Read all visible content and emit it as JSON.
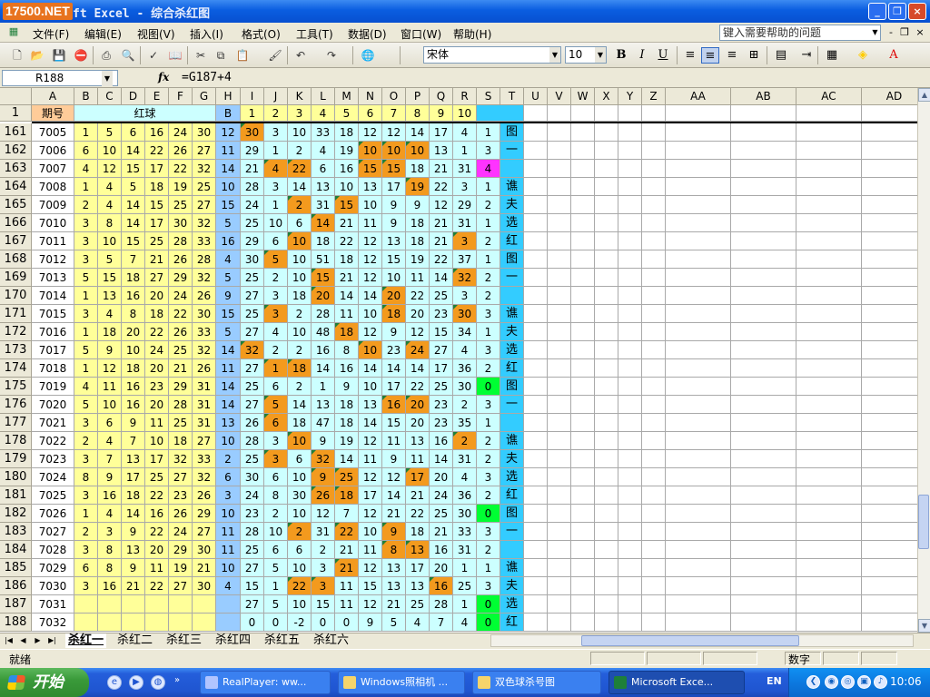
{
  "window": {
    "logo": "17500.NET",
    "title": "ft Excel - 综合杀红图",
    "min": "_",
    "restore": "❐",
    "close": "×"
  },
  "menu": [
    "文件(F)",
    "编辑(E)",
    "视图(V)",
    "插入(I)",
    "格式(O)",
    "工具(T)",
    "数据(D)",
    "窗口(W)",
    "帮助(H)"
  ],
  "help_placeholder": "键入需要帮助的问题",
  "toolbar": {
    "font": "宋体",
    "size": "10",
    "bold": "B",
    "italic": "I",
    "underline": "U"
  },
  "formula": {
    "namebox": "R188",
    "fx": "fx",
    "content": "=G187+4"
  },
  "columns": [
    "A",
    "B",
    "C",
    "D",
    "E",
    "F",
    "G",
    "H",
    "I",
    "J",
    "K",
    "L",
    "M",
    "N",
    "O",
    "P",
    "Q",
    "R",
    "S",
    "T",
    "U",
    "V",
    "W",
    "X",
    "Y",
    "Z",
    "AA",
    "AB",
    "AC",
    "AD"
  ],
  "header_row": {
    "row": "1",
    "period": "期号",
    "red": "红球",
    "blue": "B",
    "nums": [
      "1",
      "2",
      "3",
      "4",
      "5",
      "6",
      "7",
      "8",
      "9",
      "10"
    ]
  },
  "rows": [
    {
      "r": "161",
      "p": "7005",
      "red": [
        "1",
        "5",
        "6",
        "16",
        "24",
        "30"
      ],
      "b": "12",
      "kill": [
        "30",
        "3",
        "10",
        "33",
        "18",
        "12",
        "12",
        "14",
        "17",
        "4"
      ],
      "s": "1",
      "t": "图"
    },
    {
      "r": "162",
      "p": "7006",
      "red": [
        "6",
        "10",
        "14",
        "22",
        "26",
        "27"
      ],
      "b": "11",
      "kill": [
        "29",
        "1",
        "2",
        "4",
        "19",
        "10",
        "10",
        "10",
        "13",
        "1"
      ],
      "s": "3",
      "t": "一"
    },
    {
      "r": "163",
      "p": "7007",
      "red": [
        "4",
        "12",
        "15",
        "17",
        "22",
        "32"
      ],
      "b": "14",
      "kill": [
        "21",
        "4",
        "22",
        "6",
        "16",
        "15",
        "15",
        "18",
        "21",
        "31"
      ],
      "s": "4",
      "t": ""
    },
    {
      "r": "164",
      "p": "7008",
      "red": [
        "1",
        "4",
        "5",
        "18",
        "19",
        "25"
      ],
      "b": "10",
      "kill": [
        "28",
        "3",
        "14",
        "13",
        "10",
        "13",
        "17",
        "19",
        "22",
        "3"
      ],
      "s": "1",
      "t": "谯"
    },
    {
      "r": "165",
      "p": "7009",
      "red": [
        "2",
        "4",
        "14",
        "15",
        "25",
        "27"
      ],
      "b": "15",
      "kill": [
        "24",
        "1",
        "2",
        "31",
        "15",
        "10",
        "9",
        "9",
        "12",
        "29"
      ],
      "s": "2",
      "t": "夫"
    },
    {
      "r": "166",
      "p": "7010",
      "red": [
        "3",
        "8",
        "14",
        "17",
        "30",
        "32"
      ],
      "b": "5",
      "kill": [
        "25",
        "10",
        "6",
        "14",
        "21",
        "11",
        "9",
        "18",
        "21",
        "31"
      ],
      "s": "1",
      "t": "选"
    },
    {
      "r": "167",
      "p": "7011",
      "red": [
        "3",
        "10",
        "15",
        "25",
        "28",
        "33"
      ],
      "b": "16",
      "kill": [
        "29",
        "6",
        "10",
        "18",
        "22",
        "12",
        "13",
        "18",
        "21",
        "3"
      ],
      "s": "2",
      "t": "红"
    },
    {
      "r": "168",
      "p": "7012",
      "red": [
        "3",
        "5",
        "7",
        "21",
        "26",
        "28"
      ],
      "b": "4",
      "kill": [
        "30",
        "5",
        "10",
        "51",
        "18",
        "12",
        "15",
        "19",
        "22",
        "37"
      ],
      "s": "1",
      "t": "图"
    },
    {
      "r": "169",
      "p": "7013",
      "red": [
        "5",
        "15",
        "18",
        "27",
        "29",
        "32"
      ],
      "b": "5",
      "kill": [
        "25",
        "2",
        "10",
        "15",
        "21",
        "12",
        "10",
        "11",
        "14",
        "32"
      ],
      "s": "2",
      "t": "一"
    },
    {
      "r": "170",
      "p": "7014",
      "red": [
        "1",
        "13",
        "16",
        "20",
        "24",
        "26"
      ],
      "b": "9",
      "kill": [
        "27",
        "3",
        "18",
        "20",
        "14",
        "14",
        "20",
        "22",
        "25",
        "3"
      ],
      "s": "2",
      "t": ""
    },
    {
      "r": "171",
      "p": "7015",
      "red": [
        "3",
        "4",
        "8",
        "18",
        "22",
        "30"
      ],
      "b": "15",
      "kill": [
        "25",
        "3",
        "2",
        "28",
        "11",
        "10",
        "18",
        "20",
        "23",
        "30"
      ],
      "s": "3",
      "t": "谯"
    },
    {
      "r": "172",
      "p": "7016",
      "red": [
        "1",
        "18",
        "20",
        "22",
        "26",
        "33"
      ],
      "b": "5",
      "kill": [
        "27",
        "4",
        "10",
        "48",
        "18",
        "12",
        "9",
        "12",
        "15",
        "34"
      ],
      "s": "1",
      "t": "夫"
    },
    {
      "r": "173",
      "p": "7017",
      "red": [
        "5",
        "9",
        "10",
        "24",
        "25",
        "32"
      ],
      "b": "14",
      "kill": [
        "32",
        "2",
        "2",
        "16",
        "8",
        "10",
        "23",
        "24",
        "27",
        "4"
      ],
      "s": "3",
      "t": "选"
    },
    {
      "r": "174",
      "p": "7018",
      "red": [
        "1",
        "12",
        "18",
        "20",
        "21",
        "26"
      ],
      "b": "11",
      "kill": [
        "27",
        "1",
        "18",
        "14",
        "16",
        "14",
        "14",
        "14",
        "17",
        "36"
      ],
      "s": "2",
      "t": "红"
    },
    {
      "r": "175",
      "p": "7019",
      "red": [
        "4",
        "11",
        "16",
        "23",
        "29",
        "31"
      ],
      "b": "14",
      "kill": [
        "25",
        "6",
        "2",
        "1",
        "9",
        "10",
        "17",
        "22",
        "25",
        "30"
      ],
      "s": "0",
      "t": "图"
    },
    {
      "r": "176",
      "p": "7020",
      "red": [
        "5",
        "10",
        "16",
        "20",
        "28",
        "31"
      ],
      "b": "14",
      "kill": [
        "27",
        "5",
        "14",
        "13",
        "18",
        "13",
        "16",
        "20",
        "23",
        "2"
      ],
      "s": "3",
      "t": "一"
    },
    {
      "r": "177",
      "p": "7021",
      "red": [
        "3",
        "6",
        "9",
        "11",
        "25",
        "31"
      ],
      "b": "13",
      "kill": [
        "26",
        "6",
        "18",
        "47",
        "18",
        "14",
        "15",
        "20",
        "23",
        "35"
      ],
      "s": "1",
      "t": ""
    },
    {
      "r": "178",
      "p": "7022",
      "red": [
        "2",
        "4",
        "7",
        "10",
        "18",
        "27"
      ],
      "b": "10",
      "kill": [
        "28",
        "3",
        "10",
        "9",
        "19",
        "12",
        "11",
        "13",
        "16",
        "2"
      ],
      "s": "2",
      "t": "谯"
    },
    {
      "r": "179",
      "p": "7023",
      "red": [
        "3",
        "7",
        "13",
        "17",
        "32",
        "33"
      ],
      "b": "2",
      "kill": [
        "25",
        "3",
        "6",
        "32",
        "14",
        "11",
        "9",
        "11",
        "14",
        "31"
      ],
      "s": "2",
      "t": "夫"
    },
    {
      "r": "180",
      "p": "7024",
      "red": [
        "8",
        "9",
        "17",
        "25",
        "27",
        "32"
      ],
      "b": "6",
      "kill": [
        "30",
        "6",
        "10",
        "9",
        "25",
        "12",
        "12",
        "17",
        "20",
        "4"
      ],
      "s": "3",
      "t": "选"
    },
    {
      "r": "181",
      "p": "7025",
      "red": [
        "3",
        "16",
        "18",
        "22",
        "23",
        "26"
      ],
      "b": "3",
      "kill": [
        "24",
        "8",
        "30",
        "26",
        "18",
        "17",
        "14",
        "21",
        "24",
        "36"
      ],
      "s": "2",
      "t": "红"
    },
    {
      "r": "182",
      "p": "7026",
      "red": [
        "1",
        "4",
        "14",
        "16",
        "26",
        "29"
      ],
      "b": "10",
      "kill": [
        "23",
        "2",
        "10",
        "12",
        "7",
        "12",
        "21",
        "22",
        "25",
        "30"
      ],
      "s": "0",
      "t": "图"
    },
    {
      "r": "183",
      "p": "7027",
      "red": [
        "2",
        "3",
        "9",
        "22",
        "24",
        "27"
      ],
      "b": "11",
      "kill": [
        "28",
        "10",
        "2",
        "31",
        "22",
        "10",
        "9",
        "18",
        "21",
        "33"
      ],
      "s": "3",
      "t": "一"
    },
    {
      "r": "184",
      "p": "7028",
      "red": [
        "3",
        "8",
        "13",
        "20",
        "29",
        "30"
      ],
      "b": "11",
      "kill": [
        "25",
        "6",
        "6",
        "2",
        "21",
        "11",
        "8",
        "13",
        "16",
        "31"
      ],
      "s": "2",
      "t": ""
    },
    {
      "r": "185",
      "p": "7029",
      "red": [
        "6",
        "8",
        "9",
        "11",
        "19",
        "21"
      ],
      "b": "10",
      "kill": [
        "27",
        "5",
        "10",
        "3",
        "21",
        "12",
        "13",
        "17",
        "20",
        "1"
      ],
      "s": "1",
      "t": "谯"
    },
    {
      "r": "186",
      "p": "7030",
      "red": [
        "3",
        "16",
        "21",
        "22",
        "27",
        "30"
      ],
      "b": "4",
      "kill": [
        "15",
        "1",
        "22",
        "3",
        "11",
        "15",
        "13",
        "13",
        "16",
        "25"
      ],
      "s": "3",
      "t": "夫"
    },
    {
      "r": "187",
      "p": "7031",
      "red": [
        "",
        "",
        "",
        "",
        "",
        ""
      ],
      "b": "",
      "kill": [
        "27",
        "5",
        "10",
        "15",
        "11",
        "12",
        "21",
        "25",
        "28",
        "1"
      ],
      "s": "0",
      "t": "选"
    },
    {
      "r": "188",
      "p": "7032",
      "red": [
        "",
        "",
        "",
        "",
        "",
        ""
      ],
      "b": "",
      "kill": [
        "0",
        "0",
        "-2",
        "0",
        "0",
        "9",
        "5",
        "4",
        "7",
        "4"
      ],
      "s": "0",
      "t": "红"
    }
  ],
  "sheets": [
    "杀红一",
    "杀红二",
    "杀红三",
    "杀红四",
    "杀红五",
    "杀红六"
  ],
  "status": {
    "left": "就绪",
    "mode": "数字"
  },
  "taskbar": {
    "start": "开始",
    "tasks": [
      "RealPlayer: ww...",
      "Windows照相机 ...",
      "双色球杀号图",
      "Microsoft Exce..."
    ],
    "lang": "EN",
    "clock": "10:06"
  },
  "colors": {
    "orange": "#f39a1e",
    "yellow": "#ffff99",
    "lightblue": "#ccffff",
    "cyan": "#33ccff",
    "header_blue": "#99ccff",
    "green": "#00ff33",
    "magenta": "#ff33ff"
  }
}
